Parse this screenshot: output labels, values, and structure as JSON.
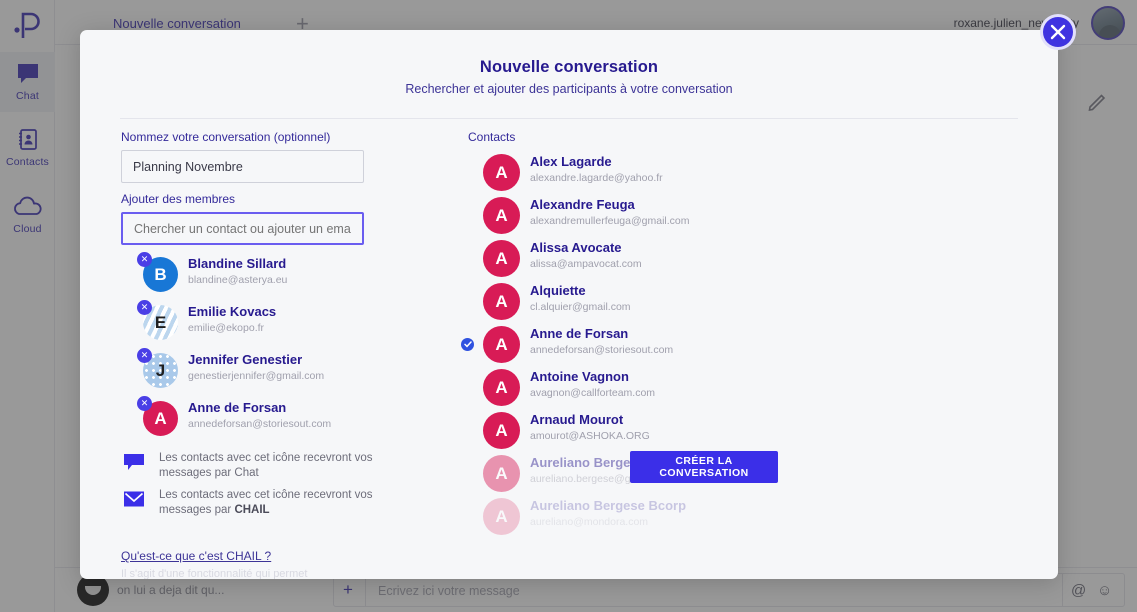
{
  "app": {
    "logo_icon": "pensee-logo-icon",
    "nav": [
      {
        "label": "Chat",
        "icon": "chat-bubble-icon",
        "active": true
      },
      {
        "label": "Contacts",
        "icon": "address-book-icon",
        "active": false
      },
      {
        "label": "Cloud",
        "icon": "cloud-icon",
        "active": false
      }
    ],
    "topbar": {
      "tab_label": "Nouvelle conversation",
      "add_tab_icon": "plus-icon",
      "user_name": "roxane.julien_newentity",
      "avatar_icon": "user-avatar"
    },
    "bottombar": {
      "preview_text": "on lui a deja dit qu...",
      "add_icon": "plus-icon",
      "message_placeholder": "Ecrivez ici votre message",
      "mention_icon": "at-icon",
      "emoji_icon": "smiley-icon"
    },
    "edit_icon": "pencil-icon"
  },
  "modal": {
    "title": "Nouvelle conversation",
    "subtitle": "Rechercher et ajouter des participants à votre conversation",
    "close_icon": "close-icon",
    "left": {
      "name_label": "Nommez votre conversation (optionnel)",
      "name_value": "Planning Novembre",
      "members_label": "Ajouter des membres",
      "search_placeholder": "Chercher un contact ou ajouter un email",
      "search_value": "",
      "selected": [
        {
          "initial": "B",
          "name": "Blandine Sillard",
          "email": "blandine@asterya.eu",
          "avatar_style": "av-blue",
          "remove_icon": "remove-icon"
        },
        {
          "initial": "E",
          "name": "Emilie Kovacs",
          "email": "emilie@ekopo.fr",
          "avatar_style": "av-stripe",
          "remove_icon": "remove-icon"
        },
        {
          "initial": "J",
          "name": "Jennifer Genestier",
          "email": "genestierjennifer@gmail.com",
          "avatar_style": "av-dots",
          "remove_icon": "remove-icon"
        },
        {
          "initial": "A",
          "name": "Anne de Forsan",
          "email": "annedeforsan@storiesout.com",
          "avatar_style": "av-pink",
          "remove_icon": "remove-icon"
        }
      ],
      "legend": [
        {
          "icon": "chat-bubble-icon",
          "text_prefix": "Les contacts avec cet icône recevront vos messages par Chat",
          "text_bold": ""
        },
        {
          "icon": "envelope-icon",
          "text_prefix": "Les contacts avec cet icône recevront vos messages par ",
          "text_bold": "CHAIL"
        }
      ],
      "chail_link": "Qu'est-ce que c'est CHAIL ?",
      "chail_faded": "Il s'agit d'une fonctionnalité qui permet"
    },
    "right": {
      "contacts_label": "Contacts",
      "contacts": [
        {
          "initial": "A",
          "name": "Alex Lagarde",
          "email": "alexandre.lagarde@yahoo.fr",
          "selected": false,
          "channel_icon": "envelope-icon",
          "fade": ""
        },
        {
          "initial": "A",
          "name": "Alexandre Feuga",
          "email": "alexandremullerfeuga@gmail.com",
          "selected": false,
          "channel_icon": "envelope-icon",
          "fade": ""
        },
        {
          "initial": "A",
          "name": "Alissa Avocate",
          "email": "alissa@ampavocat.com",
          "selected": false,
          "channel_icon": "envelope-icon",
          "fade": ""
        },
        {
          "initial": "A",
          "name": "Alquiette",
          "email": "cl.alquier@gmail.com",
          "selected": false,
          "channel_icon": "envelope-icon",
          "fade": ""
        },
        {
          "initial": "A",
          "name": "Anne de Forsan",
          "email": "annedeforsan@storiesout.com",
          "selected": true,
          "channel_icon": "chat-bubble-outline-icon",
          "fade": ""
        },
        {
          "initial": "A",
          "name": "Antoine Vagnon",
          "email": "avagnon@callforteam.com",
          "selected": false,
          "channel_icon": "envelope-icon",
          "fade": ""
        },
        {
          "initial": "A",
          "name": "Arnaud Mourot",
          "email": "amourot@ASHOKA.ORG",
          "selected": false,
          "channel_icon": "envelope-icon",
          "fade": ""
        },
        {
          "initial": "A",
          "name": "Aureliano Bergese Bcorp",
          "email": "aureliano.bergese@gmail.com",
          "selected": false,
          "channel_icon": "envelope-icon",
          "fade": "fade-1"
        },
        {
          "initial": "A",
          "name": "Aureliano Bergese Bcorp",
          "email": "aureliano@mondora.com",
          "selected": false,
          "channel_icon": "envelope-icon",
          "fade": "fade-2"
        }
      ],
      "create_button": "CRÉER LA CONVERSATION"
    }
  },
  "colors": {
    "accent_blue": "#3b2fe8",
    "title_indigo": "#271a8f",
    "avatar_pink": "#d81b56",
    "avatar_blue": "#1877d6",
    "muted_gray": "#a0a0ad"
  }
}
